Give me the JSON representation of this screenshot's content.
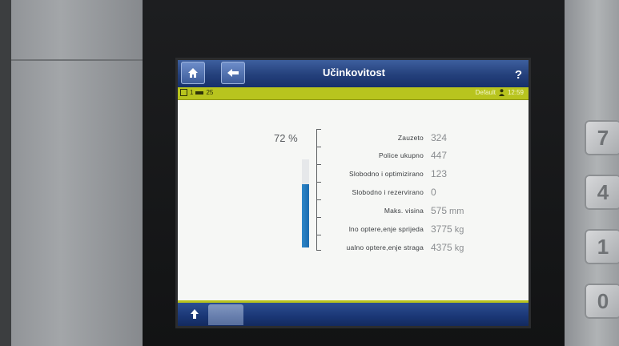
{
  "header": {
    "title": "Učinkovitost",
    "help_label": "?",
    "home_icon": "home-icon",
    "back_icon": "arrow-left-icon"
  },
  "statusbar": {
    "slot": "1",
    "count": "25",
    "user": "Default",
    "time": "12:59"
  },
  "gauge": {
    "percent_label": "72 %",
    "fill_fraction": 0.72,
    "color": "#1f75bb"
  },
  "metrics": [
    {
      "label": "Zauzeto",
      "value": "324",
      "unit": ""
    },
    {
      "label": "Police ukupno",
      "value": "447",
      "unit": ""
    },
    {
      "label": "Slobodno i optimizirano",
      "value": "123",
      "unit": ""
    },
    {
      "label": "Slobodno i rezervirano",
      "value": "0",
      "unit": ""
    },
    {
      "label": "Maks. visina",
      "value": "575",
      "unit": "mm"
    },
    {
      "label": "lno optere,enje sprijeda",
      "value": "3775",
      "unit": "kg"
    },
    {
      "label": "ualno optere,enje straga",
      "value": "4375",
      "unit": "kg"
    }
  ],
  "keypad": [
    "7",
    "4",
    "1",
    "0"
  ],
  "colors": {
    "accent_bar": "#b8c41e",
    "header_blue": "#24407b"
  }
}
